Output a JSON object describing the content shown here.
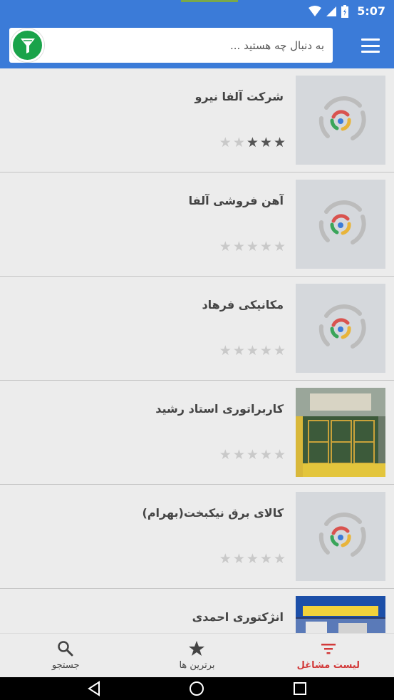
{
  "status_bar": {
    "time": "5:07"
  },
  "toolbar": {
    "search_placeholder": "به دنبال چه هستید ..."
  },
  "items": [
    {
      "title": "شرکت آلفا نیرو",
      "rating": 3,
      "image": "placeholder"
    },
    {
      "title": "آهن فروشی آلفا",
      "rating": 0,
      "image": "placeholder"
    },
    {
      "title": "مکانیکی فرهاد",
      "rating": 0,
      "image": "placeholder"
    },
    {
      "title": "کاربراتوری استاد رشید",
      "rating": 0,
      "image": "shop-photo"
    },
    {
      "title": "کالای برق نیکبخت(بهرام)",
      "rating": 0,
      "image": "placeholder"
    },
    {
      "title": "انژکتوری احمدی",
      "rating": 0,
      "image": "shop-photo-2"
    }
  ],
  "bottom_nav": {
    "search_label": "جستجو",
    "top_label": "برترین ها",
    "list_label": "لیست مشاغل"
  },
  "colors": {
    "primary": "#3b7bd8",
    "accent": "#d23a3a",
    "filter": "#1aa34a"
  }
}
